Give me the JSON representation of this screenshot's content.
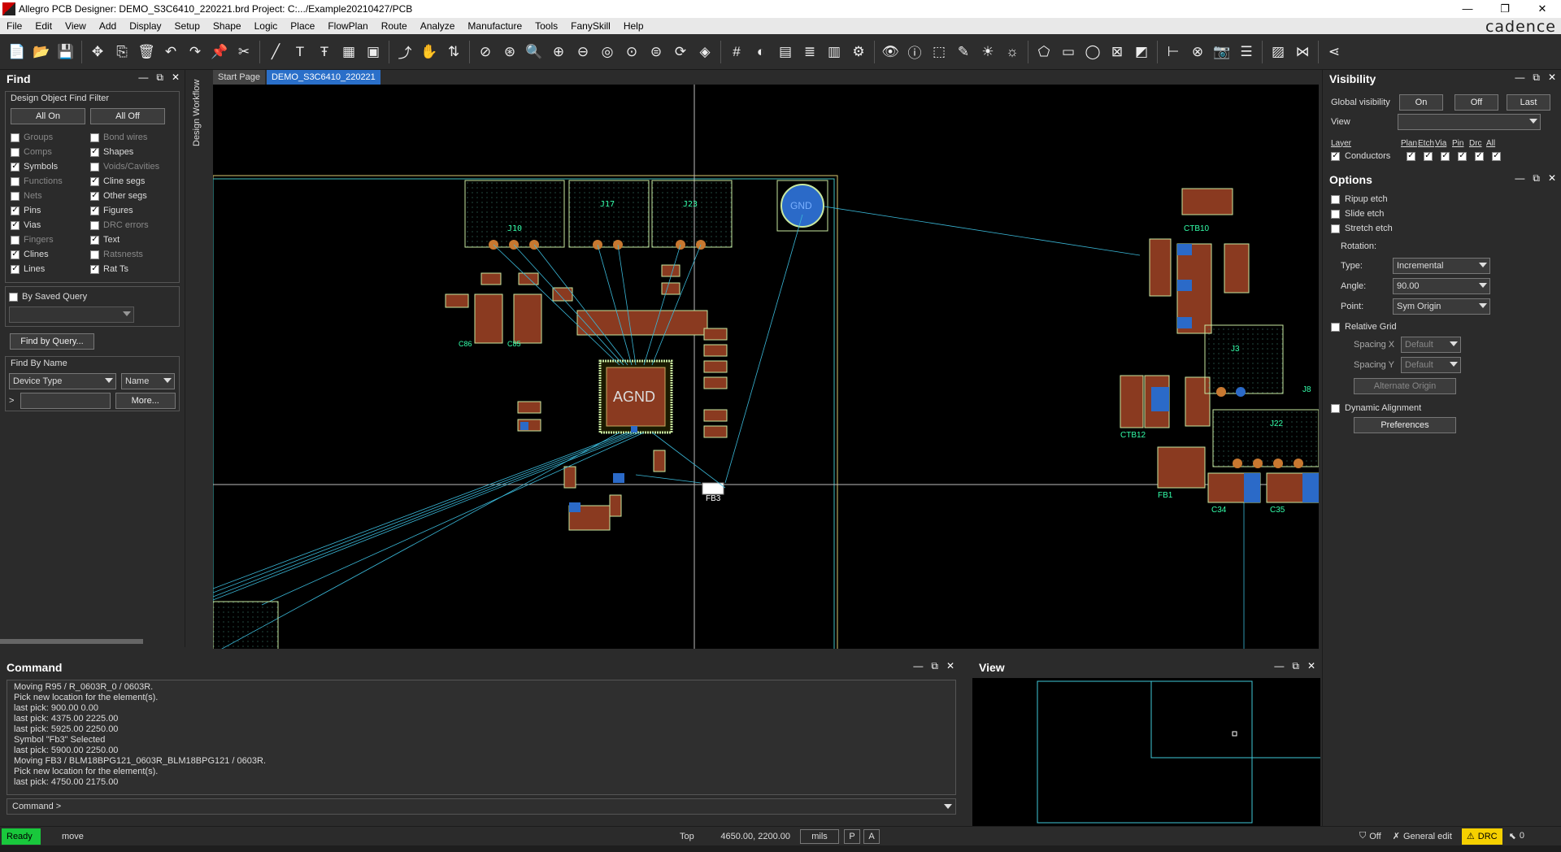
{
  "window": {
    "title": "Allegro PCB Designer: DEMO_S3C6410_220221.brd  Project: C:.../Example20210427/PCB",
    "min": "—",
    "max": "❐",
    "close": "✕"
  },
  "menu": [
    "File",
    "Edit",
    "View",
    "Add",
    "Display",
    "Setup",
    "Shape",
    "Logic",
    "Place",
    "FlowPlan",
    "Route",
    "Analyze",
    "Manufacture",
    "Tools",
    "FanySkill",
    "Help"
  ],
  "brand": "cadence",
  "find": {
    "title": "Find",
    "ctl_min": "—",
    "ctl_float": "⧉",
    "ctl_close": "✕",
    "filter_title": "Design Object Find Filter",
    "all_on": "All On",
    "all_off": "All Off",
    "items": [
      {
        "label": "Groups",
        "checked": false
      },
      {
        "label": "Bond wires",
        "checked": false
      },
      {
        "label": "Comps",
        "checked": false
      },
      {
        "label": "Shapes",
        "checked": true
      },
      {
        "label": "Symbols",
        "checked": true
      },
      {
        "label": "Voids/Cavities",
        "checked": false
      },
      {
        "label": "Functions",
        "checked": false
      },
      {
        "label": "Cline segs",
        "checked": true
      },
      {
        "label": "Nets",
        "checked": false
      },
      {
        "label": "Other segs",
        "checked": true
      },
      {
        "label": "Pins",
        "checked": true
      },
      {
        "label": "Figures",
        "checked": true
      },
      {
        "label": "Vias",
        "checked": true
      },
      {
        "label": "DRC errors",
        "checked": false
      },
      {
        "label": "Fingers",
        "checked": false
      },
      {
        "label": "Text",
        "checked": true
      },
      {
        "label": "Clines",
        "checked": true
      },
      {
        "label": "Ratsnests",
        "checked": false
      },
      {
        "label": "Lines",
        "checked": true
      },
      {
        "label": "Rat Ts",
        "checked": true
      }
    ],
    "by_saved_query": "By Saved Query",
    "find_by_query": "Find by Query...",
    "find_by_name": "Find By Name",
    "device_type": "Device Type",
    "name_sel": "Name",
    "prefix": ">",
    "more": "More..."
  },
  "workflow_label": "Design Workflow",
  "tabs": [
    {
      "label": "Start Page",
      "active": false
    },
    {
      "label": "DEMO_S3C6410_220221",
      "active": true
    }
  ],
  "canvas_labels": {
    "agnd": "AGND",
    "gnd": "GND",
    "j10": "J10",
    "j17": "J17",
    "j23": "J23",
    "j3": "J3",
    "j22": "J22",
    "fb3": "FB3",
    "ctb10": "CTB10",
    "ctb12": "CTB12",
    "c34": "C34",
    "c35": "C35",
    "c86": "C86",
    "c85": "C85",
    "j8": "J8",
    "fb1": "FB1"
  },
  "visibility": {
    "title": "Visibility",
    "global": "Global visibility",
    "on": "On",
    "off": "Off",
    "last": "Last",
    "view": "View",
    "layer": "Layer",
    "cols": [
      "Plan",
      "Etch",
      "Via",
      "Pin",
      "Drc",
      "All"
    ],
    "conductors": "Conductors"
  },
  "options": {
    "title": "Options",
    "ripup": "Ripup etch",
    "slide": "Slide etch",
    "stretch": "Stretch etch",
    "rotation": "Rotation:",
    "type_lbl": "Type:",
    "type_val": "Incremental",
    "angle_lbl": "Angle:",
    "angle_val": "90.00",
    "point_lbl": "Point:",
    "point_val": "Sym Origin",
    "relative_grid": "Relative Grid",
    "spacing_x": "Spacing  X",
    "spacing_y": "Spacing  Y",
    "default": "Default",
    "alt_origin": "Alternate Origin",
    "dynamic": "Dynamic Alignment",
    "preferences": "Preferences"
  },
  "command": {
    "title": "Command",
    "log": [
      "Moving R95 / R_0603R_0 / 0603R.",
      "Pick new location for the element(s).",
      "last pick:  900.00 0.00",
      "last pick:  4375.00 2225.00",
      "last pick:  5925.00 2250.00",
      "Symbol \"Fb3\" Selected",
      "last pick:  5900.00 2250.00",
      "Moving FB3 / BLM18BPG121_0603R_BLM18BPG121 / 0603R.",
      "Pick new location for the element(s).",
      "last pick:  4750.00 2175.00"
    ],
    "prompt": "Command >"
  },
  "view": {
    "title": "View"
  },
  "status": {
    "ready": "Ready",
    "cmd": "move",
    "layer": "Top",
    "coords": "4650.00, 2200.00",
    "units": "mils",
    "p": "P",
    "a": "A",
    "off": "Off",
    "mode": "General edit",
    "drc": "DRC",
    "count": "0"
  }
}
